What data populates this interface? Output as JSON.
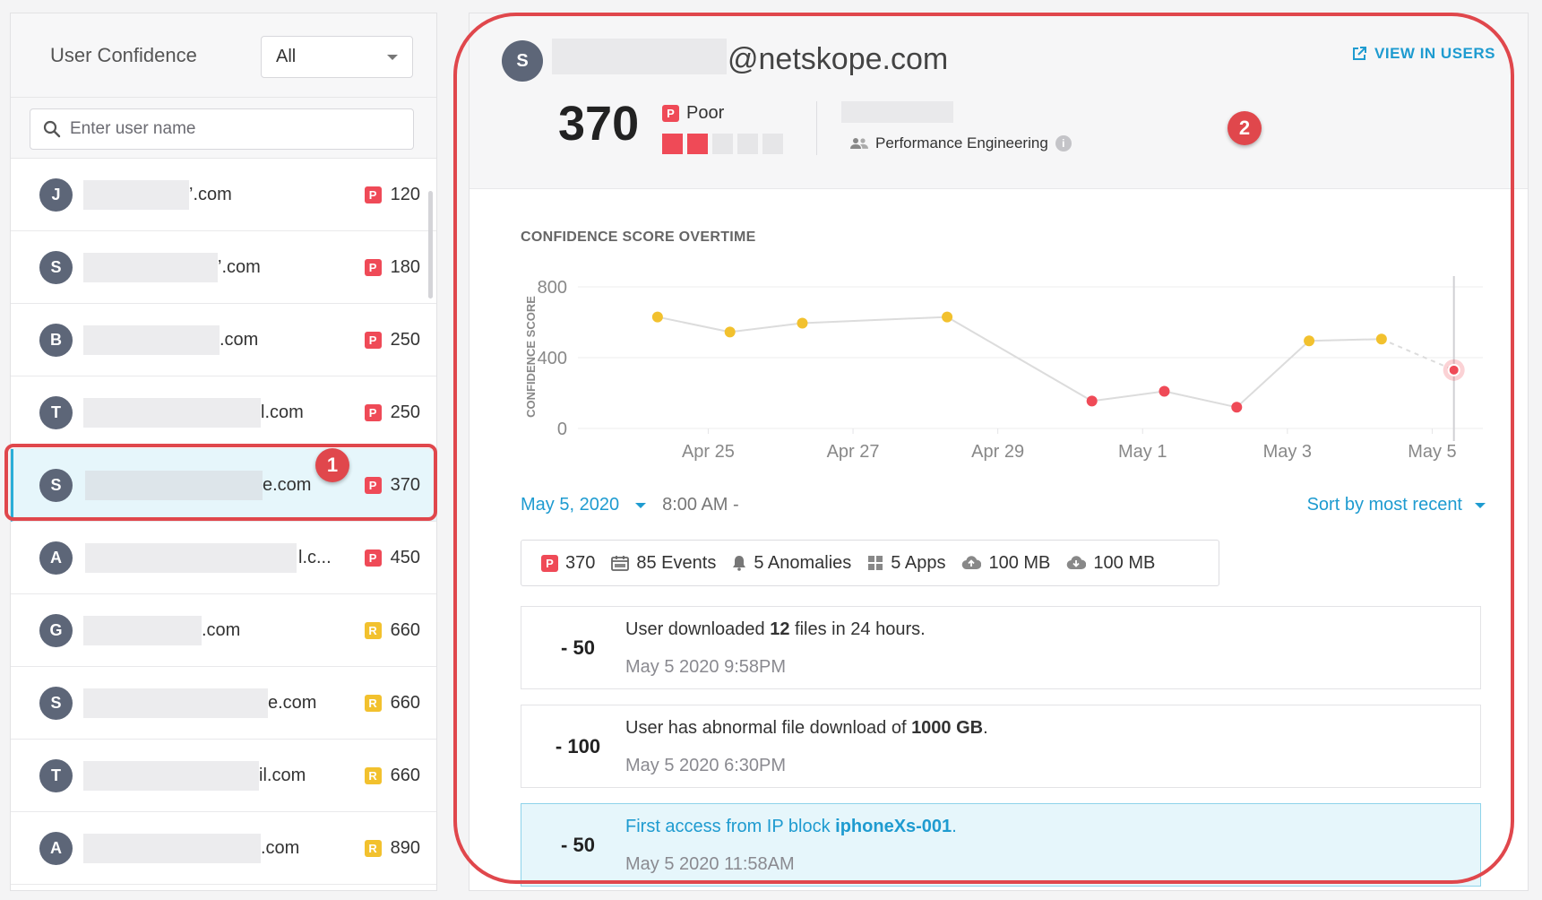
{
  "left_panel": {
    "title": "User Confidence",
    "filter_value": "All",
    "search_placeholder": "Enter user name",
    "users": [
      {
        "initial": "J",
        "email_suffix": "’.com",
        "level": "P",
        "score": "120"
      },
      {
        "initial": "S",
        "email_suffix": "’.com",
        "level": "P",
        "score": "180"
      },
      {
        "initial": "B",
        "email_suffix": ".com",
        "level": "P",
        "score": "250"
      },
      {
        "initial": "T",
        "email_suffix": "l.com",
        "level": "P",
        "score": "250"
      },
      {
        "initial": "S",
        "email_suffix": "e.com",
        "level": "P",
        "score": "370"
      },
      {
        "initial": "A",
        "email_suffix": "l.c...",
        "level": "P",
        "score": "450"
      },
      {
        "initial": "G",
        "email_suffix": ".com",
        "level": "R",
        "score": "660"
      },
      {
        "initial": "S",
        "email_suffix": "e.com",
        "level": "R",
        "score": "660"
      },
      {
        "initial": "T",
        "email_suffix": "il.com",
        "level": "R",
        "score": "660"
      },
      {
        "initial": "A",
        "email_suffix": ".com",
        "level": "R",
        "score": "890"
      }
    ]
  },
  "detail": {
    "avatar_initial": "S",
    "email_domain": "@netskope.com",
    "view_link": "VIEW IN USERS",
    "score": "370",
    "level_badge": "P",
    "level_label": "Poor",
    "level_filled": 2,
    "level_total": 5,
    "department": "Performance Engineering",
    "info_glyph": "i"
  },
  "chart_title": "CONFIDENCE SCORE OVERTIME",
  "chart_data": {
    "type": "line",
    "title": "CONFIDENCE SCORE OVERTIME",
    "ylabel": "CONFIDENCE SCORE",
    "xlabel": "",
    "ylim": [
      0,
      800
    ],
    "y_ticks": [
      0,
      400,
      800
    ],
    "x_tick_labels": [
      "Apr 25",
      "Apr 27",
      "Apr 29",
      "May 1",
      "May 3",
      "May 5"
    ],
    "x_tick_days": [
      25,
      27,
      29,
      31,
      33,
      35
    ],
    "xlim_days": [
      23.2,
      35.7
    ],
    "grid": true,
    "points": [
      {
        "day": 24.3,
        "value": 630,
        "status": "risky"
      },
      {
        "day": 25.3,
        "value": 545,
        "status": "risky"
      },
      {
        "day": 26.3,
        "value": 595,
        "status": "risky"
      },
      {
        "day": 28.3,
        "value": 630,
        "status": "risky"
      },
      {
        "day": 30.3,
        "value": 155,
        "status": "poor"
      },
      {
        "day": 31.3,
        "value": 210,
        "status": "poor"
      },
      {
        "day": 32.3,
        "value": 120,
        "status": "poor"
      },
      {
        "day": 33.3,
        "value": 495,
        "status": "risky"
      },
      {
        "day": 34.3,
        "value": 505,
        "status": "risky"
      },
      {
        "day": 35.3,
        "value": 330,
        "status": "poor",
        "selected": true
      }
    ],
    "colors": {
      "risky": "#f2c12e",
      "poor": "#ef4a57",
      "line": "#dcdcdc"
    }
  },
  "date_filter": {
    "date": "May 5, 2020",
    "time": "8:00 AM -"
  },
  "sort_label": "Sort by most recent",
  "summary": {
    "score": "370",
    "events": "85 Events",
    "anomalies": "5 Anomalies",
    "apps": "5 Apps",
    "upload": "100 MB",
    "download": "100 MB"
  },
  "events": [
    {
      "delta": "- 50",
      "text_before": "User downloaded ",
      "bold": "12",
      "text_after": " files in 24 hours.",
      "time": "May 5 2020 9:58PM"
    },
    {
      "delta": "- 100",
      "text_before": "User has abnormal file download of ",
      "bold": "1000 GB",
      "text_after": ".",
      "time": "May 5 2020 6:30PM"
    },
    {
      "delta": "- 50",
      "text_before": "First access from IP block ",
      "bold": "iphoneXs-001",
      "text_after": ".",
      "time": "May 5 2020 11:58AM"
    }
  ],
  "callouts": {
    "one": "1",
    "two": "2"
  },
  "colors": {
    "accent": "#1e9bd0",
    "poor": "#ef4a57",
    "risky": "#f2c12e",
    "callout": "#e0474c"
  }
}
